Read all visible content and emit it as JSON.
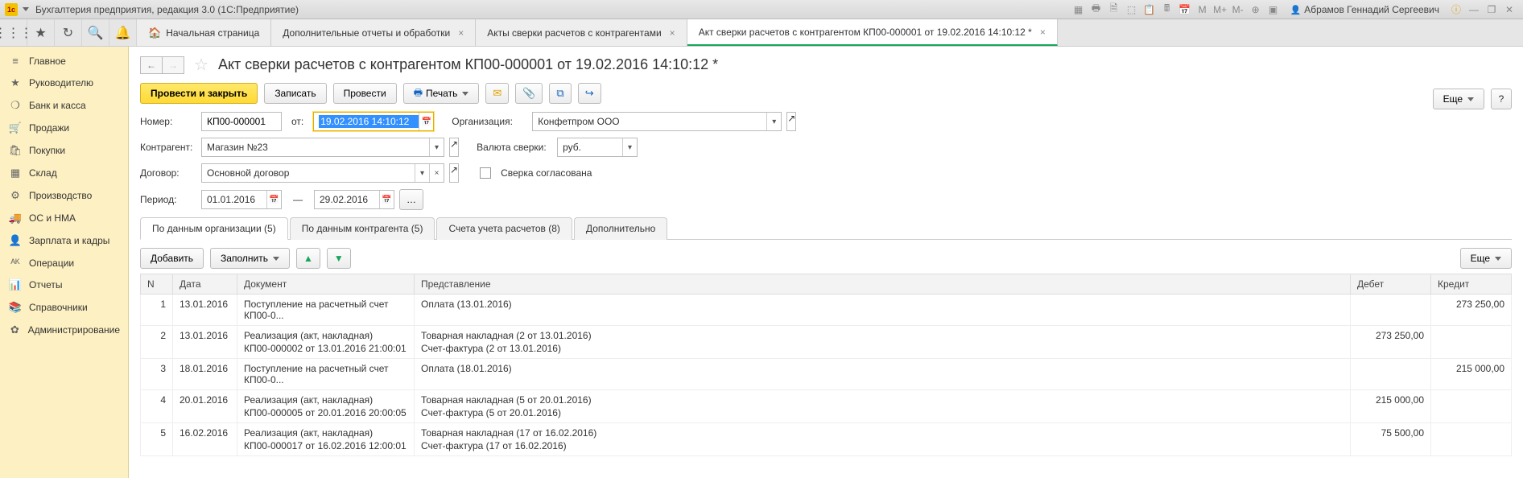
{
  "titlebar": {
    "app_title": "Бухгалтерия предприятия, редакция 3.0 (1С:Предприятие)",
    "user": "Абрамов Геннадий Сергеевич",
    "m_labels": [
      "M",
      "M+",
      "M-"
    ]
  },
  "top_tabs": [
    {
      "label": "Начальная страница",
      "home": true,
      "closable": false
    },
    {
      "label": "Дополнительные отчеты и обработки",
      "closable": true
    },
    {
      "label": "Акты сверки расчетов с контрагентами",
      "closable": true
    },
    {
      "label": "Акт сверки расчетов с контрагентом КП00-000001 от 19.02.2016 14:10:12 *",
      "closable": true,
      "active": true
    }
  ],
  "sidebar": [
    {
      "icon": "≡",
      "label": "Главное"
    },
    {
      "icon": "★",
      "label": "Руководителю"
    },
    {
      "icon": "❍",
      "label": "Банк и касса"
    },
    {
      "icon": "🛒",
      "label": "Продажи"
    },
    {
      "icon": "🛍",
      "label": "Покупки"
    },
    {
      "icon": "▦",
      "label": "Склад"
    },
    {
      "icon": "⚙",
      "label": "Производство"
    },
    {
      "icon": "🚚",
      "label": "ОС и НМА"
    },
    {
      "icon": "👤",
      "label": "Зарплата и кадры"
    },
    {
      "icon": "ᴬᴷ",
      "label": "Операции"
    },
    {
      "icon": "📊",
      "label": "Отчеты"
    },
    {
      "icon": "📚",
      "label": "Справочники"
    },
    {
      "icon": "✿",
      "label": "Администрирование"
    }
  ],
  "page": {
    "title": "Акт сверки расчетов с контрагентом КП00-000001 от 19.02.2016 14:10:12 *"
  },
  "cmd": {
    "post_close": "Провести и закрыть",
    "write": "Записать",
    "post": "Провести",
    "print": "Печать",
    "more": "Еще"
  },
  "form": {
    "number_label": "Номер:",
    "number": "КП00-000001",
    "from_label": "от:",
    "from": "19.02.2016 14:10:12",
    "org_label": "Организация:",
    "org": "Конфетпром ООО",
    "partner_label": "Контрагент:",
    "partner": "Магазин №23",
    "currency_label": "Валюта сверки:",
    "currency": "руб.",
    "contract_label": "Договор:",
    "contract": "Основной договор",
    "agreed_label": "Сверка согласована",
    "period_label": "Период:",
    "period_from": "01.01.2016",
    "period_dash": "—",
    "period_to": "29.02.2016"
  },
  "subtabs": [
    {
      "label": "По данным организации (5)",
      "active": true
    },
    {
      "label": "По данным контрагента (5)"
    },
    {
      "label": "Счета учета расчетов (8)"
    },
    {
      "label": "Дополнительно"
    }
  ],
  "tbltool": {
    "add": "Добавить",
    "fill": "Заполнить",
    "more": "Еще"
  },
  "table": {
    "headers": {
      "n": "N",
      "date": "Дата",
      "doc": "Документ",
      "repr": "Представление",
      "debit": "Дебет",
      "credit": "Кредит"
    },
    "rows": [
      {
        "n": "1",
        "date": "13.01.2016",
        "doc": "Поступление на расчетный счет КП00-0...",
        "doc2": "",
        "repr": "Оплата (13.01.2016)",
        "repr2": "",
        "debit": "",
        "credit": "273 250,00"
      },
      {
        "n": "2",
        "date": "13.01.2016",
        "doc": "Реализация (акт, накладная)",
        "doc2": "КП00-000002 от 13.01.2016 21:00:01",
        "repr": "Товарная накладная (2 от 13.01.2016)",
        "repr2": "Счет-фактура (2 от 13.01.2016)",
        "debit": "273 250,00",
        "credit": ""
      },
      {
        "n": "3",
        "date": "18.01.2016",
        "doc": "Поступление на расчетный счет КП00-0...",
        "doc2": "",
        "repr": "Оплата (18.01.2016)",
        "repr2": "",
        "debit": "",
        "credit": "215 000,00"
      },
      {
        "n": "4",
        "date": "20.01.2016",
        "doc": "Реализация (акт, накладная)",
        "doc2": "КП00-000005 от 20.01.2016 20:00:05",
        "repr": "Товарная накладная (5 от 20.01.2016)",
        "repr2": "Счет-фактура (5 от 20.01.2016)",
        "debit": "215 000,00",
        "credit": ""
      },
      {
        "n": "5",
        "date": "16.02.2016",
        "doc": "Реализация (акт, накладная)",
        "doc2": "КП00-000017 от 16.02.2016 12:00:01",
        "repr": "Товарная накладная (17 от 16.02.2016)",
        "repr2": "Счет-фактура (17 от 16.02.2016)",
        "debit": "75 500,00",
        "credit": ""
      }
    ]
  }
}
